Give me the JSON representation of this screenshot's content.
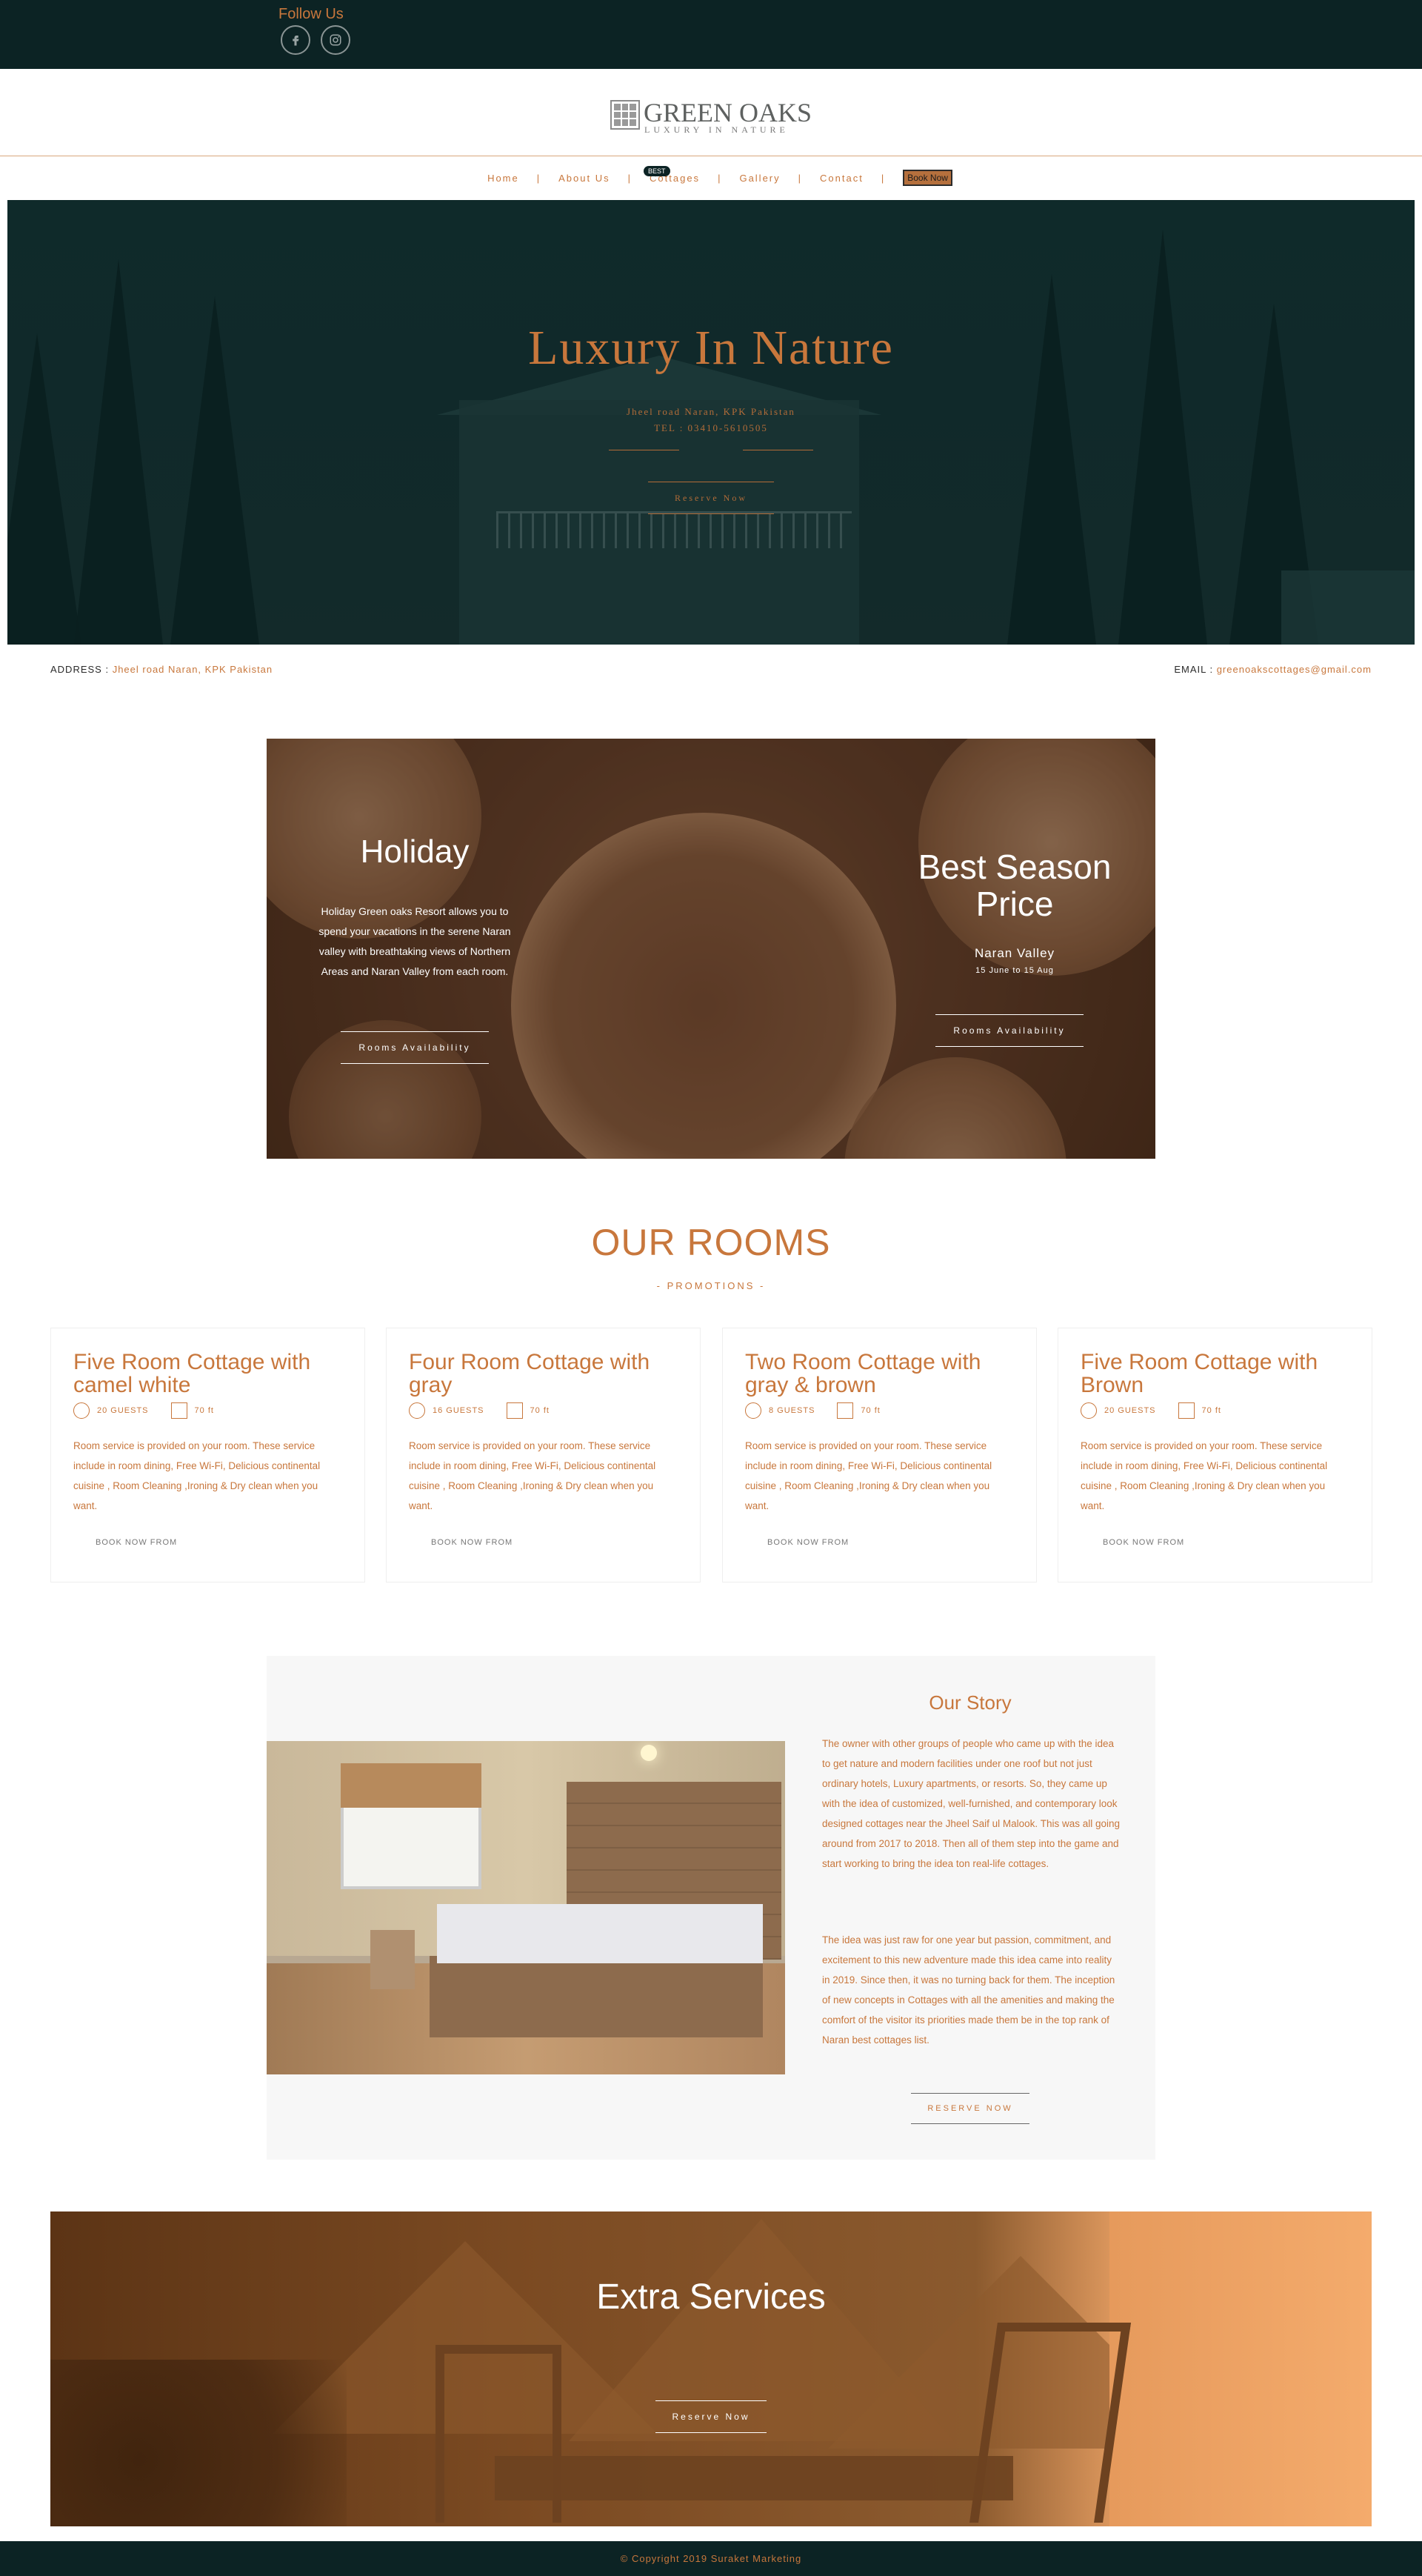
{
  "topbar": {
    "follow_label": "Follow Us",
    "icons": [
      "facebook-icon",
      "instagram-icon"
    ]
  },
  "logo": {
    "title": "GREEN OAKS",
    "subtitle": "LUXURY IN NATURE"
  },
  "nav": {
    "items": [
      "Home",
      "About Us",
      "Cottages",
      "Gallery",
      "Contact"
    ],
    "badge": "BEST",
    "book_label": "Book Now"
  },
  "hero": {
    "title": "Luxury In Nature",
    "address": "Jheel road Naran, KPK Pakistan",
    "tel": "TEL : 03410-5610505",
    "button": "Reserve Now"
  },
  "contact": {
    "address_label": "ADDRESS :",
    "address_value": "Jheel road Naran, KPK Pakistan",
    "email_label": "EMAIL :",
    "email_value": "greenoakscottages@gmail.com"
  },
  "promo": {
    "left_title": "Holiday",
    "left_text": "Holiday Green oaks Resort allows you to spend your vacations in the serene Naran valley with breathtaking views of Northern Areas and Naran Valley from each room.",
    "left_button": "Rooms Availability",
    "right_title": "Best Season Price",
    "right_sub": "Naran Valley",
    "right_date": "15 June to 15 Aug",
    "right_button": "Rooms Availability"
  },
  "rooms": {
    "title": "OUR ROOMS",
    "subtitle": "- PROMOTIONS -",
    "cards": [
      {
        "title": "Five Room Cottage with camel white",
        "guests": "20 GUESTS",
        "size": "70 ft",
        "desc": "Room service is provided on your room. These service include in room dining, Free Wi-Fi, Delicious continental cuisine , Room Cleaning ,Ironing & Dry clean when you want.",
        "book": "BOOK NOW FROM"
      },
      {
        "title": "Four Room Cottage with gray",
        "guests": "16 GUESTS",
        "size": "70 ft",
        "desc": "Room service is provided on your room. These service include in room dining, Free Wi-Fi, Delicious continental cuisine , Room Cleaning ,Ironing & Dry clean when you want.",
        "book": "BOOK NOW FROM"
      },
      {
        "title": "Two Room Cottage with gray & brown",
        "guests": "8 GUESTS",
        "size": "70 ft",
        "desc": "Room service is provided on your room. These service include in room dining, Free Wi-Fi, Delicious continental cuisine , Room Cleaning ,Ironing & Dry clean when you want.",
        "book": "BOOK NOW FROM"
      },
      {
        "title": "Five Room Cottage with Brown",
        "guests": "20 GUESTS",
        "size": "70 ft",
        "desc": "Room service is provided on your room. These service include in room dining, Free Wi-Fi, Delicious continental cuisine , Room Cleaning ,Ironing & Dry clean when you want.",
        "book": "BOOK NOW FROM"
      }
    ]
  },
  "story": {
    "title": "Our Story",
    "p1": "The owner with other groups of people who came up with the idea to get nature and modern facilities under one roof but not just ordinary hotels, Luxury apartments, or resorts. So, they came up with the idea of customized, well-furnished, and contemporary look designed cottages near the Jheel Saif ul Malook. This was all going around from 2017 to 2018. Then all of them step into the game and start working to bring the idea ton real-life cottages.",
    "p2": "The idea was just raw for one year but passion, commitment, and excitement to this new adventure made this idea came into reality in 2019. Since then, it was no turning back for them. The inception of new concepts in Cottages with all the amenities and making the comfort of the visitor its priorities made them be in the top rank of Naran best cottages list.",
    "button": "RESERVE NOW"
  },
  "extra": {
    "title": "Extra Services",
    "button": "Reserve Now"
  },
  "footer": {
    "text": "© Copyright 2019 Suraket Marketing"
  },
  "colors": {
    "accent": "#c8773c",
    "dark": "#0c2324"
  }
}
